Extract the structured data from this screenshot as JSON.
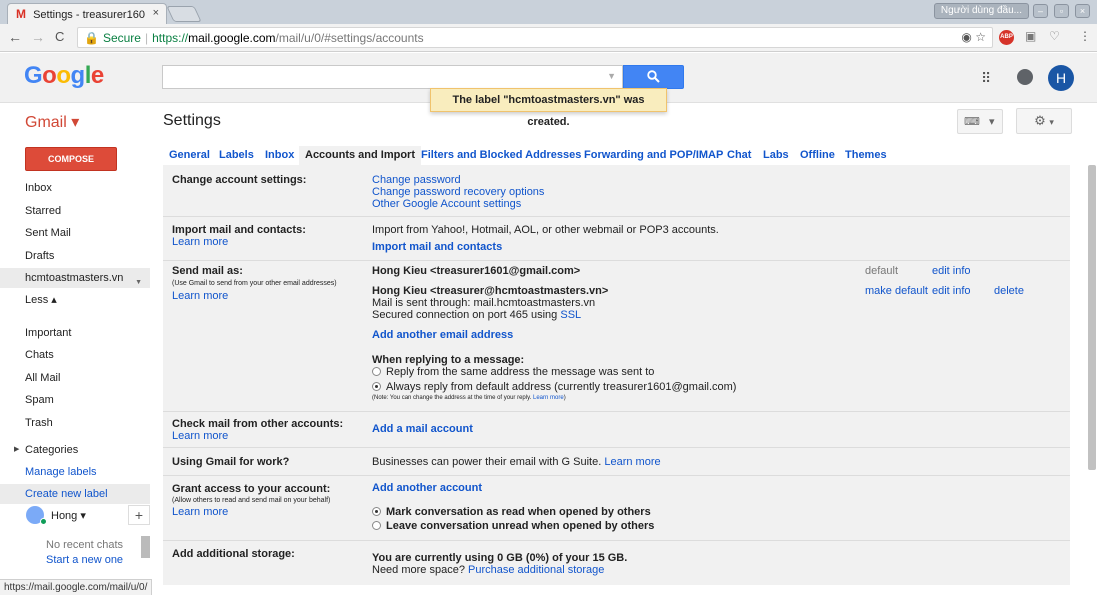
{
  "browser": {
    "tab_title": "Settings - treasurer160",
    "tab_icon": "M",
    "tab_close": "×",
    "profile": "Người dùng đầu...",
    "nav": {
      "back": "←",
      "forward": "→",
      "reload": "C"
    },
    "url": {
      "secure_label": "Secure",
      "scheme": "https://",
      "host": "mail.google.com",
      "path": "/mail/u/0/#settings/accounts"
    },
    "status_url": "https://mail.google.com/mail/u/0/"
  },
  "header": {
    "logo": "Google",
    "search_placeholder": "",
    "avatar_letter": "H",
    "toast": "The label \"hcmtoastmasters.vn\" was created."
  },
  "appbar": {
    "gmail_label": "Gmail ▾",
    "title": "Settings"
  },
  "leftnav": {
    "compose": "COMPOSE",
    "items": [
      "Inbox",
      "Starred",
      "Sent Mail",
      "Drafts",
      "hcmtoastmasters.vn",
      "Less ▴",
      "Important",
      "Chats",
      "All Mail",
      "Spam",
      "Trash",
      "Categories",
      "Manage labels",
      "Create new label"
    ],
    "hangouts_name": "Hong ▾",
    "no_recent": "No recent chats",
    "start_new": "Start a new one"
  },
  "settings": {
    "tabs": [
      "General",
      "Labels",
      "Inbox",
      "Accounts and Import",
      "Filters and Blocked Addresses",
      "Forwarding and POP/IMAP",
      "Chat",
      "Labs",
      "Offline",
      "Themes"
    ],
    "active_tab": "Accounts and Import",
    "change_account": {
      "label": "Change account settings:",
      "links": [
        "Change password",
        "Change password recovery options",
        "Other Google Account settings"
      ]
    },
    "import": {
      "label": "Import mail and contacts:",
      "learn_more": "Learn more",
      "desc": "Import from Yahoo!, Hotmail, AOL, or other webmail or POP3 accounts.",
      "action": "Import mail and contacts"
    },
    "send_as": {
      "label": "Send mail as:",
      "sub": "(Use Gmail to send from your other email addresses)",
      "learn_more": "Learn more",
      "account1": "Hong Kieu <treasurer1601@gmail.com>",
      "account1_status": "default",
      "edit_info": "edit info",
      "account2": "Hong Kieu <treasurer@hcmtoastmasters.vn>",
      "account2_via": "Mail is sent through: mail.hcmtoastmasters.vn",
      "account2_secured": "Secured connection on port 465 using",
      "ssl": "SSL",
      "make_default": "make default",
      "delete": "delete",
      "add_another": "Add another email address",
      "reply_heading": "When replying to a message:",
      "reply_opt1": "Reply from the same address the message was sent to",
      "reply_opt2": "Always reply from default address (currently treasurer1601@gmail.com)",
      "reply_note": "(Note: You can change the address at the time of your reply.",
      "reply_note_link": "Learn more",
      "reply_note_end": ")"
    },
    "check_mail": {
      "label": "Check mail from other accounts:",
      "learn_more": "Learn more",
      "action": "Add a mail account"
    },
    "work": {
      "label": "Using Gmail for work?",
      "desc": "Businesses can power their email with G Suite.",
      "learn_more": "Learn more"
    },
    "grant": {
      "label": "Grant access to your account:",
      "sub": "(Allow others to read and send mail on your behalf)",
      "learn_more": "Learn more",
      "action": "Add another account",
      "opt1": "Mark conversation as read when opened by others",
      "opt2": "Leave conversation unread when opened by others"
    },
    "storage": {
      "label": "Add additional storage:",
      "usage": "You are currently using 0 GB (0%) of your 15 GB.",
      "need_more": "Need more space?",
      "purchase": "Purchase additional storage"
    }
  },
  "icons": [
    "gmail-favicon",
    "lock-icon",
    "eye-icon",
    "star-icon",
    "adblock-icon",
    "menu-dots-icon",
    "search-icon",
    "apps-grid-icon",
    "notifications-icon",
    "keyboard-icon",
    "gear-icon",
    "chevron-down-icon",
    "plus-icon"
  ],
  "colors": {
    "brand_red": "#d14836",
    "compose_red": "#dd4b39",
    "link_blue": "#1155cc",
    "search_blue": "#4285f4",
    "toast_bg": "#f9edbe"
  }
}
